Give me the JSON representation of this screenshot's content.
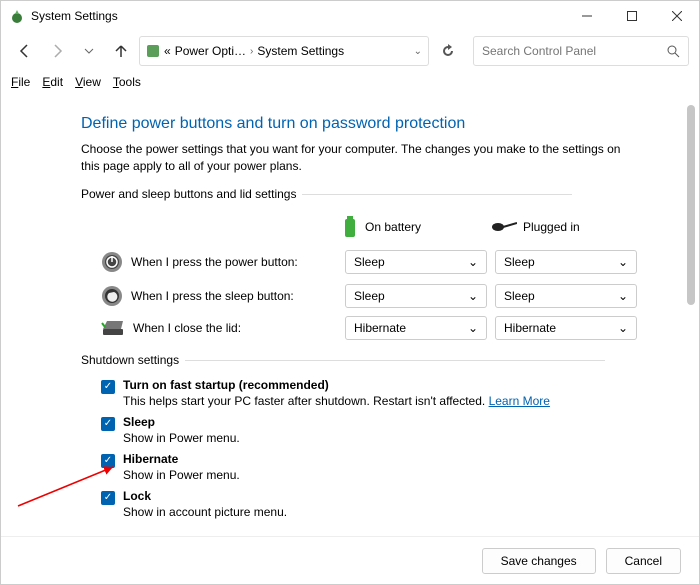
{
  "title": "System Settings",
  "breadcrumb": {
    "seg1": "Power Opti…",
    "seg2": "System Settings"
  },
  "search": {
    "placeholder": "Search Control Panel"
  },
  "menu": {
    "file": "File",
    "edit": "Edit",
    "view": "View",
    "tools": "Tools"
  },
  "page": {
    "heading": "Define power buttons and turn on password protection",
    "sub": "Choose the power settings that you want for your computer. The changes you make to the settings on this page apply to all of your power plans.",
    "group1": "Power and sleep buttons and lid settings",
    "col_battery": "On battery",
    "col_plugged": "Plugged in",
    "rows": [
      {
        "label": "When I press the power button:",
        "battery": "Sleep",
        "plugged": "Sleep"
      },
      {
        "label": "When I press the sleep button:",
        "battery": "Sleep",
        "plugged": "Sleep"
      },
      {
        "label": "When I close the lid:",
        "battery": "Hibernate",
        "plugged": "Hibernate"
      }
    ],
    "group2": "Shutdown settings",
    "shutdown": [
      {
        "label": "Turn on fast startup (recommended)",
        "desc": "This helps start your PC faster after shutdown. Restart isn't affected. ",
        "link": "Learn More"
      },
      {
        "label": "Sleep",
        "desc": "Show in Power menu."
      },
      {
        "label": "Hibernate",
        "desc": "Show in Power menu."
      },
      {
        "label": "Lock",
        "desc": "Show in account picture menu."
      }
    ]
  },
  "footer": {
    "save": "Save changes",
    "cancel": "Cancel"
  }
}
